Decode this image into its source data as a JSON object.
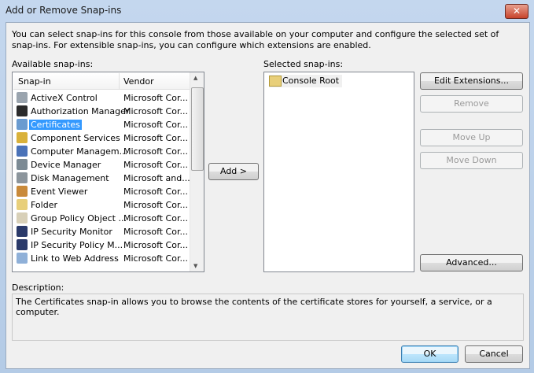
{
  "window": {
    "title": "Add or Remove Snap-ins",
    "close": "✕"
  },
  "intro": "You can select snap-ins for this console from those available on your computer and configure the selected set of snap-ins. For extensible snap-ins, you can configure which extensions are enabled.",
  "available": {
    "label": "Available snap-ins:",
    "columns": [
      "Snap-in",
      "Vendor"
    ],
    "items": [
      {
        "name": "ActiveX Control",
        "vendor": "Microsoft Cor...",
        "color": "#9aa4ae"
      },
      {
        "name": "Authorization Manager",
        "vendor": "Microsoft Cor...",
        "color": "#2b2b2b"
      },
      {
        "name": "Certificates",
        "vendor": "Microsoft Cor...",
        "color": "#6a9bd0",
        "selected": true
      },
      {
        "name": "Component Services",
        "vendor": "Microsoft Cor...",
        "color": "#d9b13a"
      },
      {
        "name": "Computer Managem...",
        "vendor": "Microsoft Cor...",
        "color": "#4a72b8"
      },
      {
        "name": "Device Manager",
        "vendor": "Microsoft Cor...",
        "color": "#7c8a94"
      },
      {
        "name": "Disk Management",
        "vendor": "Microsoft and...",
        "color": "#8c959c"
      },
      {
        "name": "Event Viewer",
        "vendor": "Microsoft Cor...",
        "color": "#c98a3a"
      },
      {
        "name": "Folder",
        "vendor": "Microsoft Cor...",
        "color": "#e8cf7a"
      },
      {
        "name": "Group Policy Object ...",
        "vendor": "Microsoft Cor...",
        "color": "#d8d0b8"
      },
      {
        "name": "IP Security Monitor",
        "vendor": "Microsoft Cor...",
        "color": "#2a3a6a"
      },
      {
        "name": "IP Security Policy M...",
        "vendor": "Microsoft Cor...",
        "color": "#2a3a6a"
      },
      {
        "name": "Link to Web Address",
        "vendor": "Microsoft Cor...",
        "color": "#8fb0d8"
      }
    ]
  },
  "add_button": "Add >",
  "selected": {
    "label": "Selected snap-ins:",
    "items": [
      "Console Root"
    ]
  },
  "buttons": {
    "edit_extensions": "Edit Extensions...",
    "remove": "Remove",
    "move_up": "Move Up",
    "move_down": "Move Down",
    "advanced": "Advanced..."
  },
  "description": {
    "label": "Description:",
    "text": "The Certificates snap-in allows you to browse the contents of the certificate stores for yourself, a service, or a computer."
  },
  "footer": {
    "ok": "OK",
    "cancel": "Cancel"
  }
}
